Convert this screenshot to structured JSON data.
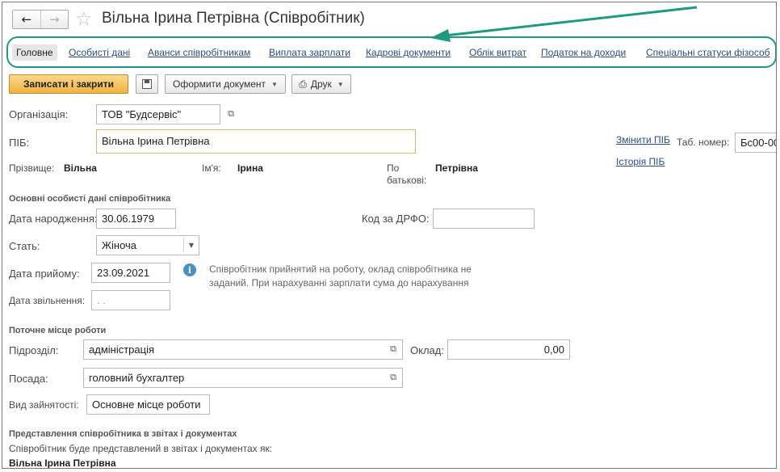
{
  "window": {
    "title": "Вільна Ірина Петрівна (Співробітник)"
  },
  "tabs": [
    {
      "label": "Головне",
      "active": true
    },
    {
      "label": "Особисті дані"
    },
    {
      "label": "Аванси співробітникам"
    },
    {
      "label": "Виплата зарплати"
    },
    {
      "label": "Кадрові документи"
    },
    {
      "label": "Облік витрат"
    },
    {
      "label": "Податок на доходи"
    },
    {
      "label": "Спеціальні статуси фізособ"
    }
  ],
  "toolbar": {
    "save_close_label": "Записати і закрити",
    "create_doc_label": "Оформити документ",
    "print_label": "Друк"
  },
  "form": {
    "organization": {
      "label": "Організація:",
      "value": "ТОВ \"Будсервіс\""
    },
    "full_name": {
      "label": "ПІБ:",
      "value": "Вільна Ірина Петрівна"
    },
    "change_name_link": "Змінити ПІБ",
    "name_history_link": "Історія ПІБ",
    "tab_number": {
      "label": "Таб. номер:",
      "value": "Бс00-00"
    },
    "surname": {
      "label": "Прізвище:",
      "value": "Вільна"
    },
    "first_name": {
      "label": "Ім'я:",
      "value": "Ірина"
    },
    "patronymic": {
      "label_line1": "По",
      "label_line2": "батькові:",
      "value": "Петрівна"
    }
  },
  "personal": {
    "section_title": "Основні особисті дані співробітника",
    "birth_date": {
      "label": "Дата народження:",
      "value": "30.06.1979"
    },
    "drfo_code": {
      "label": "Код за ДРФО:",
      "value": ""
    },
    "gender": {
      "label": "Стать:",
      "value": "Жіноча"
    },
    "hire_date": {
      "label": "Дата прийому:",
      "value": "23.09.2021"
    },
    "info_line1": "Співробітник прийнятий на роботу, оклад співробітника не",
    "info_line2": "заданий. При нарахуванні зарплати сума до нарахування",
    "dismissal_date": {
      "label": "Дата звільнення:",
      "value": " .  ."
    }
  },
  "workplace": {
    "section_title": "Поточне місце роботи",
    "department": {
      "label": "Підрозділ:",
      "value": "адміністрація"
    },
    "salary": {
      "label": "Оклад:",
      "value": "0,00"
    },
    "position": {
      "label": "Посада:",
      "value": "головний бухгалтер"
    },
    "employment_type": {
      "label": "Вид зайнятості:",
      "value": "Основне місце роботи"
    }
  },
  "representation": {
    "section_title": "Представлення співробітника в звітах і документах",
    "description": "Співробітник буде представлений в звітах і документах як:",
    "value": "Вільна Ірина Петрівна"
  },
  "colors": {
    "annotation": "#1d9b80",
    "primary_button": "#f0b33f",
    "link": "#2a4d87"
  }
}
